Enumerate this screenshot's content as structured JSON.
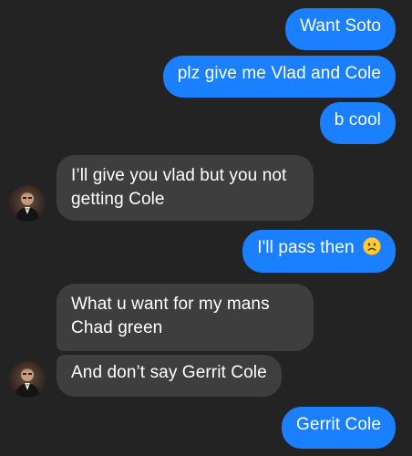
{
  "messages": {
    "m1": "Want Soto",
    "m2": "plz give me Vlad and Cole",
    "m3": "b cool",
    "m4": "I’ll give you vlad but you not getting Cole",
    "m5": "I'll pass then",
    "m6": "What u want for my mans Chad green",
    "m7": "And don’t say Gerrit Cole",
    "m8": "Gerrit Cole"
  },
  "colors": {
    "background": "#232323",
    "sent_bubble": "#1a80ff",
    "received_bubble": "#3e3e3e",
    "text": "#ffffff"
  },
  "icons": {
    "emoji": "frowning-face-emoji",
    "avatar": "contact-avatar"
  }
}
